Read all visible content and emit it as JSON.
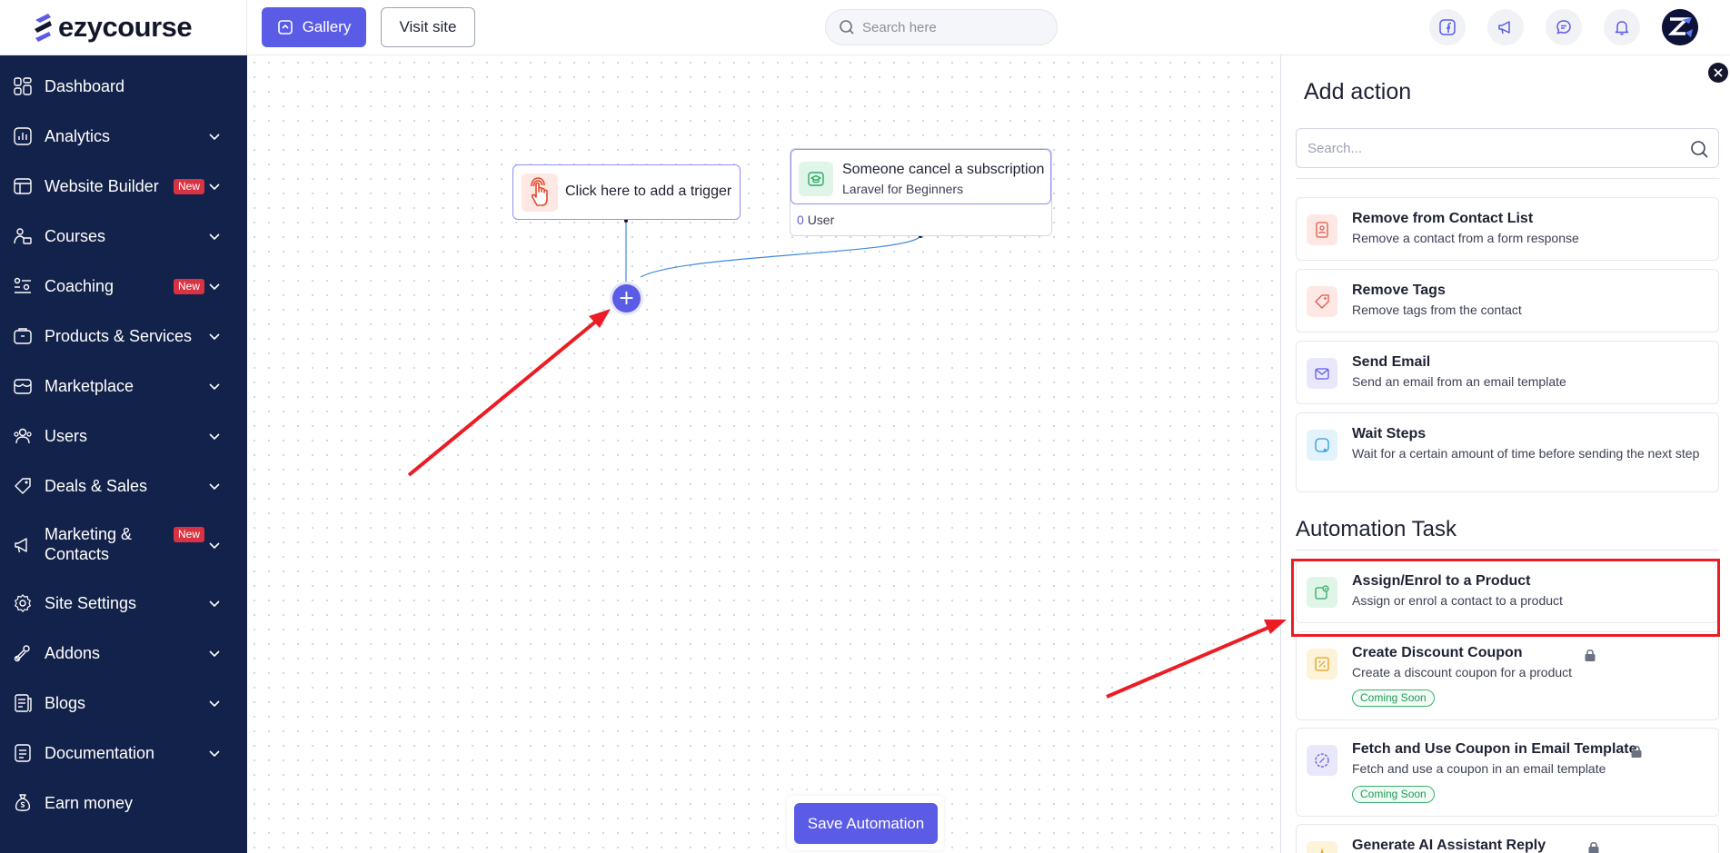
{
  "brand": {
    "name": "ezycourse"
  },
  "header": {
    "gallery_label": "Gallery",
    "visit_label": "Visit site",
    "search_placeholder": "Search here",
    "icons": [
      "facebook-icon",
      "megaphone-icon",
      "chat-icon",
      "bell-icon",
      "avatar"
    ]
  },
  "sidebar": {
    "items": [
      {
        "label": "Dashboard",
        "icon": "dashboard-icon",
        "chevron": false,
        "badge": ""
      },
      {
        "label": "Analytics",
        "icon": "analytics-icon",
        "chevron": true,
        "badge": ""
      },
      {
        "label": "Website Builder",
        "icon": "website-builder-icon",
        "chevron": true,
        "badge": "New"
      },
      {
        "label": "Courses",
        "icon": "courses-icon",
        "chevron": true,
        "badge": ""
      },
      {
        "label": "Coaching",
        "icon": "coaching-icon",
        "chevron": true,
        "badge": "New"
      },
      {
        "label": "Products & Services",
        "icon": "products-icon",
        "chevron": true,
        "badge": ""
      },
      {
        "label": "Marketplace",
        "icon": "marketplace-icon",
        "chevron": true,
        "badge": ""
      },
      {
        "label": "Users",
        "icon": "users-icon",
        "chevron": true,
        "badge": ""
      },
      {
        "label": "Deals & Sales",
        "icon": "deals-icon",
        "chevron": true,
        "badge": ""
      },
      {
        "label": "Marketing & Contacts",
        "label_line1": "Marketing &",
        "label_line2": "Contacts",
        "icon": "marketing-icon",
        "chevron": true,
        "badge": "New"
      },
      {
        "label": "Site Settings",
        "icon": "settings-icon",
        "chevron": true,
        "badge": ""
      },
      {
        "label": "Addons",
        "icon": "addons-icon",
        "chevron": true,
        "badge": ""
      },
      {
        "label": "Blogs",
        "icon": "blogs-icon",
        "chevron": true,
        "badge": ""
      },
      {
        "label": "Documentation",
        "icon": "documentation-icon",
        "chevron": true,
        "badge": ""
      },
      {
        "label": "Earn money",
        "icon": "money-bag-icon",
        "chevron": false,
        "badge": ""
      }
    ]
  },
  "canvas": {
    "trigger_label": "Click here to add a trigger",
    "event": {
      "title": "Someone cancel a subscription",
      "subtitle": "Laravel for Beginners",
      "user_count": "0",
      "user_label": "User"
    },
    "add_step_symbol": "+",
    "save_label": "Save Automation"
  },
  "panel": {
    "title": "Add action",
    "search_placeholder": "Search...",
    "actions": [
      {
        "title": "Remove from Contact List",
        "desc": "Remove a contact from a form response",
        "icon": "contact-list-icon",
        "color": "#fde8e6"
      },
      {
        "title": "Remove Tags",
        "desc": "Remove tags from the contact",
        "icon": "tag-icon",
        "color": "#fde8e6"
      },
      {
        "title": "Send Email",
        "desc": "Send an email from an email template",
        "icon": "email-icon",
        "color": "#e9e8fb"
      },
      {
        "title": "Wait Steps",
        "desc": "Wait for a certain amount of time before sending the next step",
        "icon": "wait-icon",
        "color": "#e3f3fc"
      }
    ],
    "section_title": "Automation Task",
    "tasks": [
      {
        "title": "Assign/Enrol to a Product",
        "desc": "Assign or enrol a contact to a product",
        "icon": "assign-product-icon",
        "color": "#dff5e7",
        "locked": false,
        "badge": ""
      },
      {
        "title": "Create Discount Coupon",
        "desc": "Create a discount coupon for a product",
        "icon": "coupon-icon",
        "color": "#fdf3d9",
        "locked": true,
        "badge": "Coming Soon"
      },
      {
        "title": "Fetch and Use Coupon in Email Template",
        "desc": "Fetch and use a coupon in an email template",
        "icon": "fetch-coupon-icon",
        "color": "#e9e8fb",
        "locked": true,
        "badge": "Coming Soon"
      },
      {
        "title": "Generate AI Assistant Reply",
        "desc": "",
        "icon": "ai-icon",
        "color": "#fdf3d9",
        "locked": true,
        "badge": ""
      }
    ]
  },
  "colors": {
    "accent": "#5b5ce6",
    "sidebar": "#13224a",
    "annotation": "#ec1c24",
    "new_badge": "#d93242"
  }
}
